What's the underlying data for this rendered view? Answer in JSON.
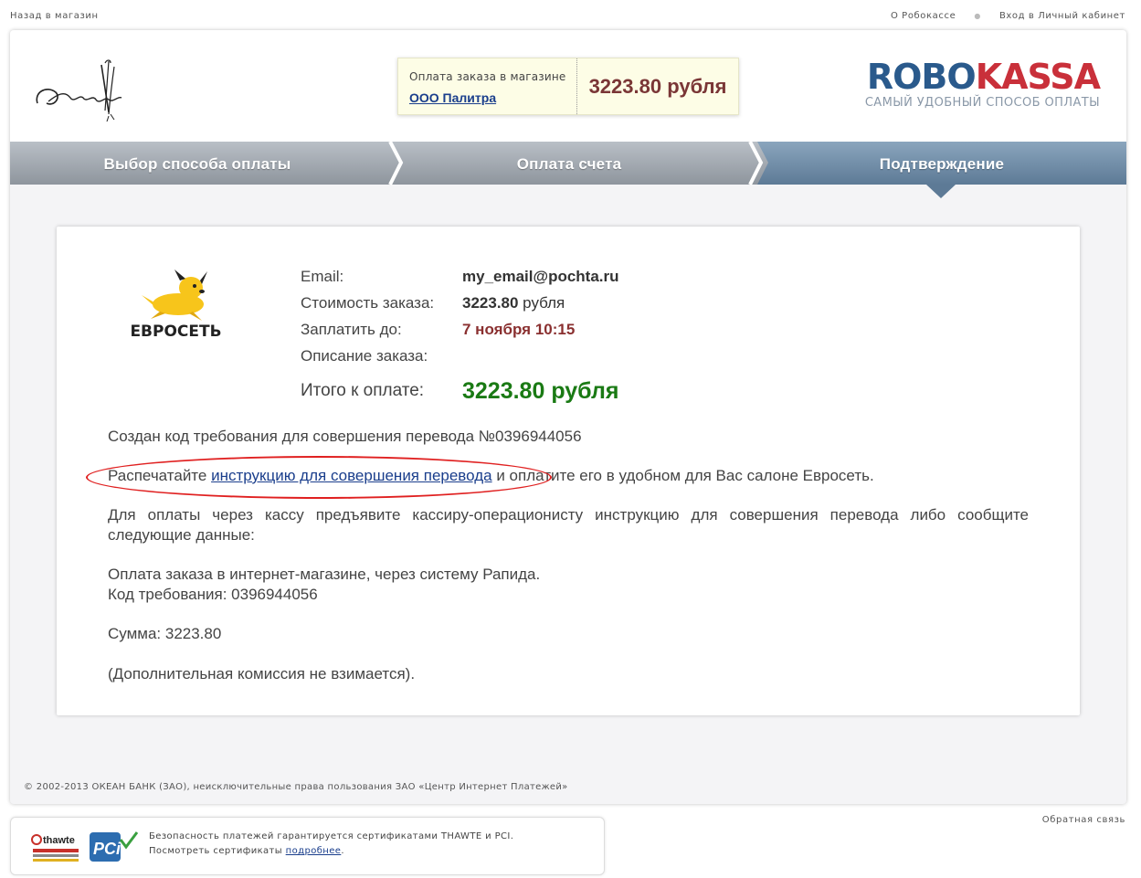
{
  "topbar": {
    "back_link": "Назад в магазин",
    "about_link": "О Робокассе",
    "login_link": "Вход в Личный кабинет"
  },
  "header": {
    "order_caption": "Оплата заказа в магазине",
    "shop_name": "ООО Палитра",
    "amount": "3223.80 рубля",
    "brand_part1": "ROBO",
    "brand_part2": "KASSA",
    "brand_tagline": "САМЫЙ УДОБНЫЙ СПОСОБ ОПЛАТЫ"
  },
  "steps": [
    {
      "label": "Выбор способа оплаты"
    },
    {
      "label": "Оплата счета"
    },
    {
      "label": "Подтверждение"
    }
  ],
  "payment_provider": "ЕВРОСЕТЬ",
  "details": {
    "email_label": "Email:",
    "email_value": "my_email@pochta.ru",
    "cost_label": "Стоимость заказа:",
    "cost_value": "3223.80",
    "cost_unit": " рубля",
    "deadline_label": "Заплатить до:",
    "deadline_value": "7 ноября 10:15",
    "description_label": "Описание заказа:",
    "total_label": "Итого к оплате:",
    "total_value": "3223.80 рубля"
  },
  "body": {
    "code_created": "Создан код требования для совершения перевода №0396944056",
    "print_prefix": "Распечатайте ",
    "print_link": "инструкцию для совершения перевода",
    "print_suffix": " и оплатите его в удобном для Вас салоне Евросеть.",
    "cashier_text": "Для оплаты через кассу предъявите кассиру-операционисту инструкцию для совершения перевода либо сообщите следующие данные:",
    "payment_line": "Оплата заказа в интернет-магазине, через систему Рапида.",
    "code_line": "Код требования: 0396944056",
    "sum_line": "Сумма: 3223.80",
    "commission_line": "(Дополнительная комиссия не взимается)."
  },
  "copyright": "© 2002-2013 ОКЕАН БАНК (ЗАО), неисключительные права пользования ЗАО «Центр Интернет Платежей»",
  "footer": {
    "security_line1": "Безопасность платежей гарантируется сертификатами THAWTE и PCI.",
    "security_line2_prefix": "Посмотреть сертификаты ",
    "security_link": "подробнее",
    "security_line2_suffix": ".",
    "feedback": "Обратная связь",
    "thawte_label": "thawte",
    "pci_label": "PCi"
  },
  "colors": {
    "accent_blue": "#2a5a8c",
    "brand_red": "#c9303a",
    "amount_red": "#7a3636",
    "total_green": "#1a7a14",
    "highlight_ellipse": "#e02020"
  }
}
